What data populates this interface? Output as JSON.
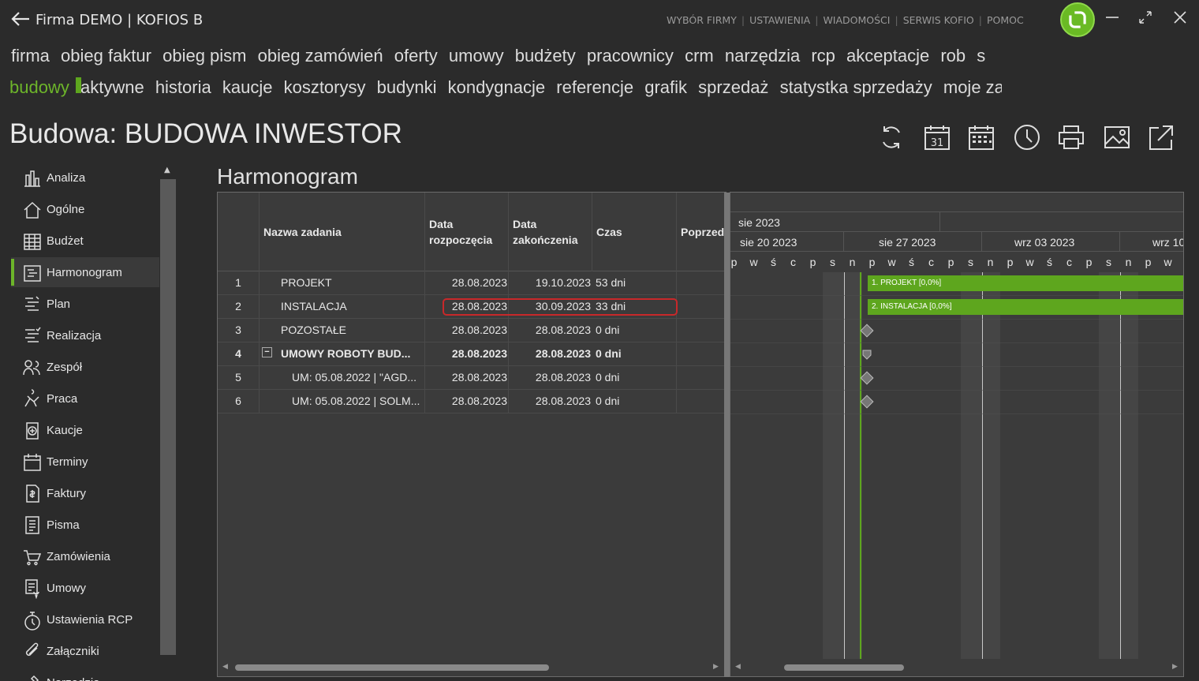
{
  "window": {
    "title": "Firma DEMO | KOFIOS B",
    "top_links": [
      "WYBÓR FIRMY",
      "USTAWIENIA",
      "WIADOMOŚCI",
      "SERWIS KOFIO",
      "POMOC"
    ],
    "accent": "#6db52a"
  },
  "menu_main": [
    "firma",
    "obieg faktur",
    "obieg pism",
    "obieg zamówień",
    "oferty",
    "umowy",
    "budżety",
    "pracownicy",
    "crm",
    "narzędzia",
    "rcp",
    "akceptacje",
    "rob",
    "s"
  ],
  "menu_sub": {
    "active": "budowy",
    "items": [
      "aktywne",
      "historia",
      "kaucje",
      "kosztorysy",
      "budynki",
      "kondygnacje",
      "referencje",
      "grafik",
      "sprzedaż",
      "statystka sprzedaży",
      "moje zadania",
      "z"
    ]
  },
  "page_title": "Budowa: BUDOWA INWESTOR",
  "toolbar": {
    "icons": [
      "refresh-icon",
      "calendar-day-icon",
      "calendar-month-icon",
      "clock-icon",
      "print-icon",
      "image-icon",
      "external-link-icon"
    ],
    "calendar_day": "31"
  },
  "sidebar": {
    "items": [
      {
        "label": "Analiza",
        "icon": "bar-chart-icon"
      },
      {
        "label": "Ogólne",
        "icon": "home-icon"
      },
      {
        "label": "Budżet",
        "icon": "table-icon"
      },
      {
        "label": "Harmonogram",
        "icon": "gantt-icon"
      },
      {
        "label": "Plan",
        "icon": "plan-list-icon"
      },
      {
        "label": "Realizacja",
        "icon": "realization-list-icon"
      },
      {
        "label": "Zespół",
        "icon": "team-icon"
      },
      {
        "label": "Praca",
        "icon": "worker-icon"
      },
      {
        "label": "Kaucje",
        "icon": "deposit-icon"
      },
      {
        "label": "Terminy",
        "icon": "calendar-icon"
      },
      {
        "label": "Faktury",
        "icon": "invoice-icon"
      },
      {
        "label": "Pisma",
        "icon": "document-icon"
      },
      {
        "label": "Zamówienia",
        "icon": "cart-icon"
      },
      {
        "label": "Umowy",
        "icon": "contract-icon"
      },
      {
        "label": "Ustawienia RCP",
        "icon": "stopwatch-icon"
      },
      {
        "label": "Załączniki",
        "icon": "paperclip-icon"
      },
      {
        "label": "Narzędzia",
        "icon": "tools-icon"
      }
    ],
    "active_index": 3
  },
  "section_title": "Harmonogram",
  "grid": {
    "columns": [
      "Nazwa zadania",
      "Data rozpoczęcia",
      "Data zakończenia",
      "Czas",
      "Poprzed"
    ],
    "column_lines": {
      "start": [
        "Data",
        "rozpoczęcia"
      ],
      "end": [
        "Data",
        "zakończenia"
      ]
    },
    "rows": [
      {
        "id": "1",
        "name": "PROJEKT",
        "start": "28.08.2023",
        "end": "19.10.2023",
        "duration": "53 dni",
        "bold": false,
        "indent": 1
      },
      {
        "id": "2",
        "name": "INSTALACJA",
        "start": "28.08.2023",
        "end": "30.09.2023",
        "duration": "33 dni",
        "bold": false,
        "indent": 1
      },
      {
        "id": "3",
        "name": "POZOSTAŁE",
        "start": "28.08.2023",
        "end": "28.08.2023",
        "duration": "0 dni",
        "bold": false,
        "indent": 1
      },
      {
        "id": "4",
        "name": "UMOWY ROBOTY BUD...",
        "start": "28.08.2023",
        "end": "28.08.2023",
        "duration": "0 dni",
        "bold": true,
        "indent": 1,
        "collapse": "−"
      },
      {
        "id": "5",
        "name": "UM: 05.08.2022 | \"AGD...",
        "start": "28.08.2023",
        "end": "28.08.2023",
        "duration": "0 dni",
        "bold": false,
        "indent": 2
      },
      {
        "id": "6",
        "name": "UM: 05.08.2022 | SOLM...",
        "start": "28.08.2023",
        "end": "28.08.2023",
        "duration": "0 dni",
        "bold": false,
        "indent": 2
      }
    ]
  },
  "gantt": {
    "month": "sie 2023",
    "weeks": [
      "sie 20 2023",
      "sie 27 2023",
      "wrz 03 2023",
      "wrz 10"
    ],
    "days": [
      "p",
      "w",
      "ś",
      "c",
      "p",
      "s",
      "n",
      "p",
      "w",
      "ś",
      "c",
      "p",
      "s",
      "n",
      "p",
      "w",
      "ś",
      "c",
      "p",
      "s",
      "n",
      "p",
      "w"
    ],
    "bars": [
      {
        "row": 1,
        "label": "1. PROJEKT [0,0%]"
      },
      {
        "row": 2,
        "label": "2. INSTALACJA [0,0%]"
      }
    ],
    "bar_color": "#5ea61e",
    "milestones": [
      3,
      5,
      6
    ],
    "summary_marker": 4
  }
}
